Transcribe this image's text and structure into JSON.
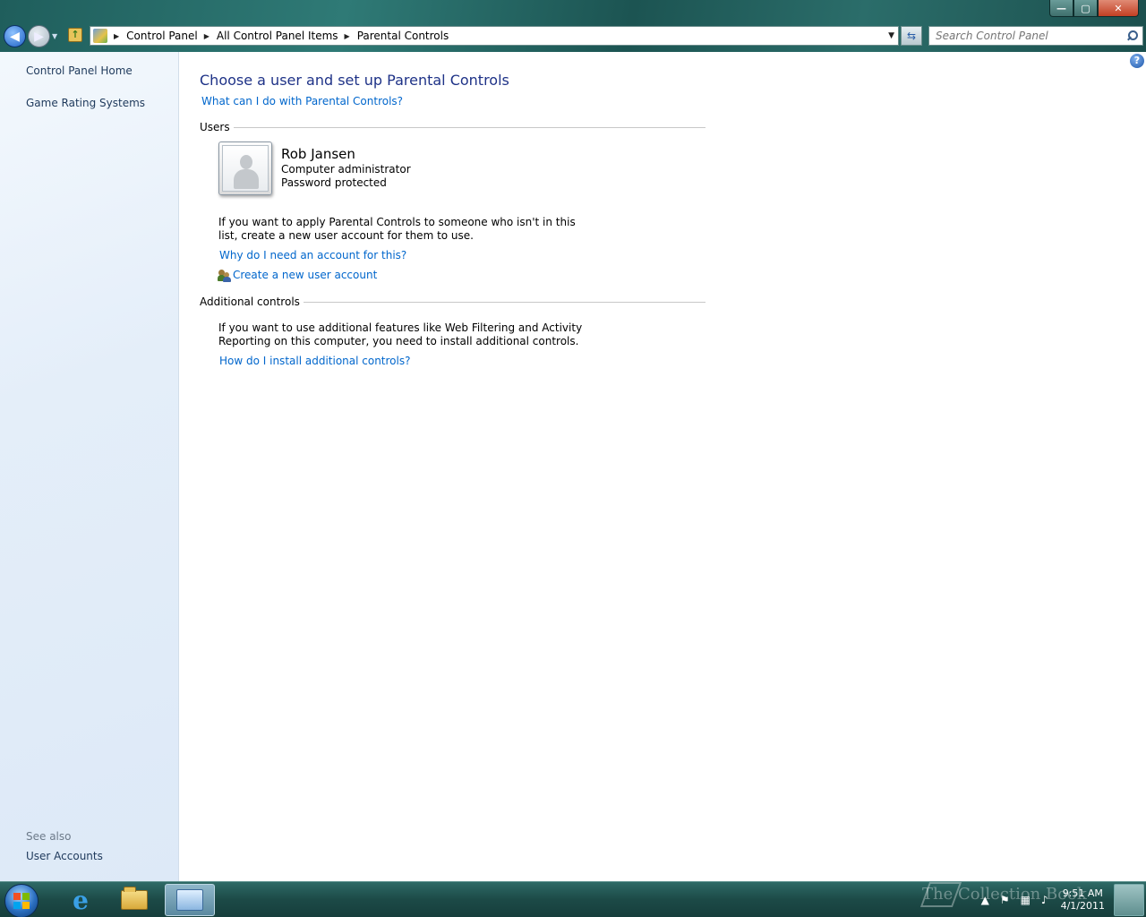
{
  "window": {
    "caption": {
      "minimize": "—",
      "maximize": "▢",
      "close": "✕"
    }
  },
  "toolbar": {
    "breadcrumbs": [
      "Control Panel",
      "All Control Panel Items",
      "Parental Controls"
    ],
    "search_placeholder": "Search Control Panel"
  },
  "sidebar": {
    "links": [
      "Control Panel Home",
      "Game Rating Systems"
    ],
    "see_also_label": "See also",
    "see_also_links": [
      "User Accounts"
    ]
  },
  "main": {
    "title": "Choose a user and set up Parental Controls",
    "what_can_link": "What can I do with Parental Controls?",
    "users_section": "Users",
    "user": {
      "name": "Rob Jansen",
      "role": "Computer administrator",
      "password_status": "Password protected"
    },
    "add_user_text": "If you want to apply Parental Controls to someone who isn't in this list, create a new user account for them to use.",
    "why_account_link": "Why do I need an account for this?",
    "create_account_link": "Create a new user account",
    "additional_section": "Additional controls",
    "additional_text": "If you want to use additional features like Web Filtering and Activity Reporting on this computer, you need to install additional controls.",
    "install_link": "How do I install additional controls?"
  },
  "taskbar": {
    "clock_time": "9:51 AM",
    "clock_date": "4/1/2011",
    "watermark": "The Collection Book",
    "icons": [
      "start-orb",
      "internet-explorer-icon",
      "windows-explorer-icon",
      "control-panel-icon"
    ],
    "tray_icons": [
      "show-hidden-icons",
      "action-center-flag-icon",
      "network-icon",
      "volume-icon"
    ]
  },
  "colors": {
    "link": "#0066cc",
    "title": "#1e3287",
    "sidebar_link": "#1e395b",
    "frame": "#1f5e5c"
  }
}
